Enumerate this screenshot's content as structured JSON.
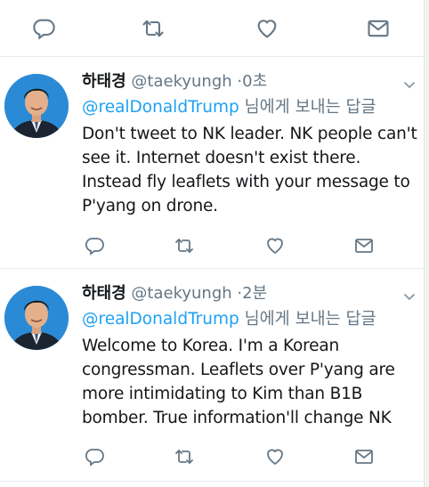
{
  "top_actions": [
    "reply-icon",
    "retweet-icon",
    "like-icon",
    "direct-message-icon"
  ],
  "tweets": [
    {
      "name": "하태경",
      "handle": "@taekyungh",
      "separator": "·",
      "time": "0초",
      "mention": "@realDonaldTrump",
      "reply_suffix": "님에게 보내는 답글",
      "lines": [
        "Don't tweet to NK leader. NK people can't",
        "see it. Internet doesn't exist there.",
        "Instead fly leaflets with your message to",
        "P'yang on drone."
      ]
    },
    {
      "name": "하태경",
      "handle": "@taekyungh",
      "separator": "·",
      "time": "2분",
      "mention": "@realDonaldTrump",
      "reply_suffix": "님에게 보내는 답글",
      "lines": [
        "Welcome to Korea. I'm a Korean",
        "congressman. Leaflets over P'yang are",
        "more intimidating to Kim than B1B",
        "bomber. True information'll change NK"
      ]
    }
  ],
  "colors": {
    "accent": "#1da1f2",
    "secondary_text": "#657786",
    "primary_text": "#14171a",
    "divider": "#e6ecf0"
  }
}
